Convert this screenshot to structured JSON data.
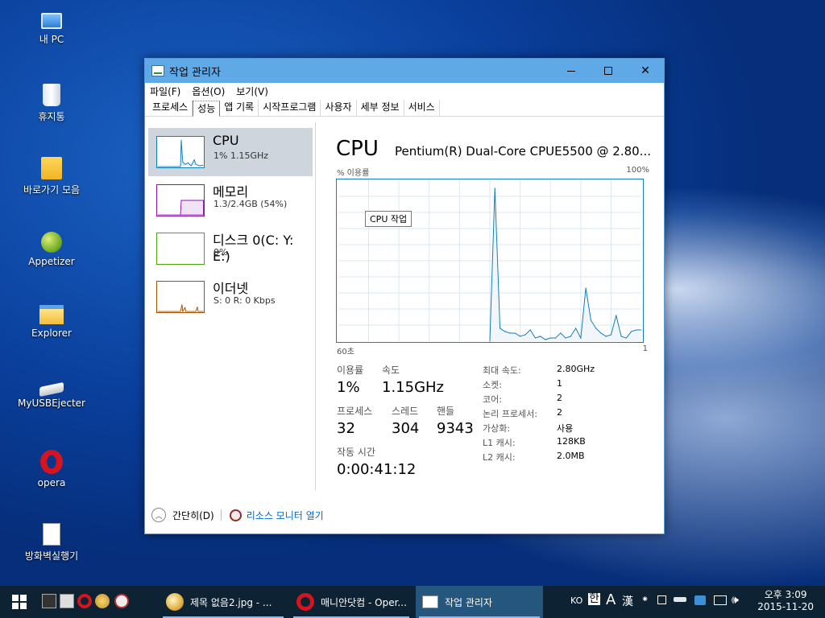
{
  "desktop": {
    "icons": [
      {
        "label": "내 PC",
        "icon": "computer-icon"
      },
      {
        "label": "휴지통",
        "icon": "recycle-bin-icon"
      },
      {
        "label": "바로가기 모음",
        "icon": "folder-icon"
      },
      {
        "label": "Appetizer",
        "icon": "appetizer-icon"
      },
      {
        "label": "Explorer",
        "icon": "explorer-icon"
      },
      {
        "label": "MyUSBEjecter",
        "icon": "usb-icon"
      },
      {
        "label": "opera",
        "icon": "opera-icon"
      },
      {
        "label": "방화벽실행기",
        "icon": "batch-file-icon"
      }
    ]
  },
  "window": {
    "title": "작업 관리자",
    "menu": [
      "파일(F)",
      "옵션(O)",
      "보기(V)"
    ],
    "tabs": [
      "프로세스",
      "성능",
      "앱 기록",
      "시작프로그램",
      "사용자",
      "세부 정보",
      "서비스"
    ],
    "active_tab": "성능"
  },
  "sidebar": {
    "items": [
      {
        "name": "CPU",
        "detail": "1% 1.15GHz",
        "color": "#117dbb"
      },
      {
        "name": "메모리",
        "detail": "1.3/2.4GB (54%)",
        "color": "#8b12ae"
      },
      {
        "name": "디스크 0(C: Y: E:)",
        "detail": "0%",
        "color": "#4da60c"
      },
      {
        "name": "이더넷",
        "detail": "S: 0 R: 0 Kbps",
        "color": "#a74f01"
      }
    ]
  },
  "main": {
    "title": "CPU",
    "cpu_name": "Pentium(R) Dual-Core CPUE5500 @ 2.80...",
    "ylabel": "% 이용률",
    "ymax_label": "100%",
    "x_left": "60초",
    "x_right": "1",
    "tooltip": "CPU 작업",
    "stats": {
      "usage_label": "이용률",
      "usage": "1%",
      "speed_label": "속도",
      "speed": "1.15GHz",
      "processes_label": "프로세스",
      "processes": "32",
      "threads_label": "스레드",
      "threads": "304",
      "handles_label": "핸들",
      "handles": "9343",
      "uptime_label": "작동 시간",
      "uptime": "0:00:41:12"
    },
    "specs": [
      {
        "label": "최대 속도:",
        "value": "2.80GHz"
      },
      {
        "label": "소켓:",
        "value": "1"
      },
      {
        "label": "코어:",
        "value": "2"
      },
      {
        "label": "논리 프로세서:",
        "value": "2"
      },
      {
        "label": "가상화:",
        "value": "사용"
      },
      {
        "label": "L1 캐시:",
        "value": "128KB"
      },
      {
        "label": "L2 캐시:",
        "value": "2.0MB"
      }
    ]
  },
  "footer": {
    "collapse": "간단히(D)",
    "resource_monitor": "리소스 모니터 열기"
  },
  "taskbar": {
    "buttons": [
      {
        "label": "제목 없음2.jpg - ...",
        "icon": "paint-icon"
      },
      {
        "label": "매니안닷컴 - Oper...",
        "icon": "opera-icon"
      },
      {
        "label": "작업 관리자",
        "icon": "task-manager-icon"
      }
    ],
    "tray": {
      "lang": "KO",
      "ime1": "한",
      "ime2": "A",
      "ime3": "漢"
    },
    "time": "오후 3:09",
    "date": "2015-11-20"
  },
  "chart_data": {
    "type": "area",
    "title": "CPU",
    "xlabel": "",
    "ylabel": "% 이용률",
    "xlim": [
      60,
      0
    ],
    "ylim": [
      0,
      100
    ],
    "x": [
      60,
      59,
      58,
      57,
      56,
      55,
      54,
      53,
      52,
      51,
      50,
      49,
      48,
      47,
      46,
      45,
      44,
      43,
      42,
      41,
      40,
      39,
      38,
      37,
      36,
      35,
      34,
      33,
      32,
      31,
      30,
      29,
      28,
      27,
      26,
      25,
      24,
      23,
      22,
      21,
      20,
      19,
      18,
      17,
      16,
      15,
      14,
      13,
      12,
      11,
      10,
      9,
      8,
      7,
      6,
      5,
      4,
      3,
      2,
      1
    ],
    "series": [
      {
        "values": [
          0,
          0,
          0,
          0,
          0,
          0,
          0,
          0,
          0,
          0,
          0,
          0,
          0,
          0,
          0,
          0,
          0,
          0,
          0,
          0,
          0,
          0,
          0,
          0,
          0,
          0,
          0,
          0,
          0,
          0,
          0,
          95,
          8,
          6,
          5,
          5,
          3,
          4,
          7,
          2,
          3,
          1,
          2,
          2,
          5,
          2,
          3,
          8,
          2,
          33,
          13,
          8,
          5,
          3,
          4,
          16,
          3,
          2,
          6,
          7
        ]
      }
    ],
    "grid": true
  }
}
